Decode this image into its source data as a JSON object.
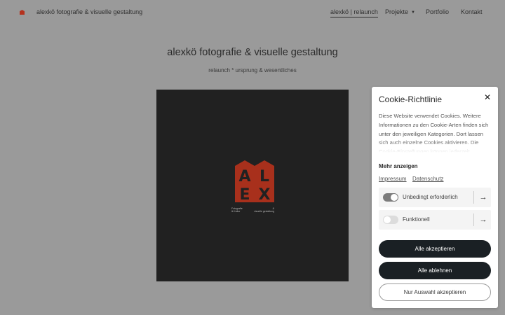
{
  "header": {
    "site_name": "alexkö fotografie & visuelle gestaltung",
    "nav": [
      {
        "label": "alexkö | relaunch",
        "active": true
      },
      {
        "label": "Projekte",
        "has_dropdown": true
      },
      {
        "label": "Portfolio"
      },
      {
        "label": "Kontakt"
      }
    ]
  },
  "page": {
    "title": "alexkö fotografie & visuelle gestaltung",
    "subtitle": "relaunch * ursprung & wesentliches"
  },
  "hero": {
    "logo_letters": [
      "A",
      "L",
      "E",
      "X"
    ],
    "caption_left": [
      "Fotografie",
      "& Kultur"
    ],
    "caption_right": [
      "&",
      "visuelle gestaltung"
    ]
  },
  "cookie": {
    "title": "Cookie-Richtlinie",
    "text": "Diese Website verwendet Cookies. Weitere Informationen zu den Cookie-Arten finden sich unter den jeweiligen Kategorien. Dort lassen sich auch einzelne Cookies aktivieren. Die Cookie-Einstellungen können jederzeit",
    "more_label": "Mehr anzeigen",
    "links": {
      "impressum": "Impressum",
      "datenschutz": "Datenschutz"
    },
    "categories": [
      {
        "label": "Unbedingt erforderlich",
        "enabled": true,
        "locked": true
      },
      {
        "label": "Funktionell",
        "enabled": false
      }
    ],
    "buttons": {
      "accept_all": "Alle akzeptieren",
      "reject_all": "Alle ablehnen",
      "accept_selection": "Nur Auswahl akzeptieren"
    }
  },
  "icons": {
    "close": "close-icon",
    "arrow": "arrow-right-icon",
    "logo": "logo-mark-icon"
  },
  "colors": {
    "overlay": "#9a9a9a",
    "brand_red": "#b4321e",
    "hero_bg": "#212121",
    "button_dark": "#1a2024",
    "toggle_on": "#7c7c7c",
    "toggle_off": "#dcdcdc"
  }
}
